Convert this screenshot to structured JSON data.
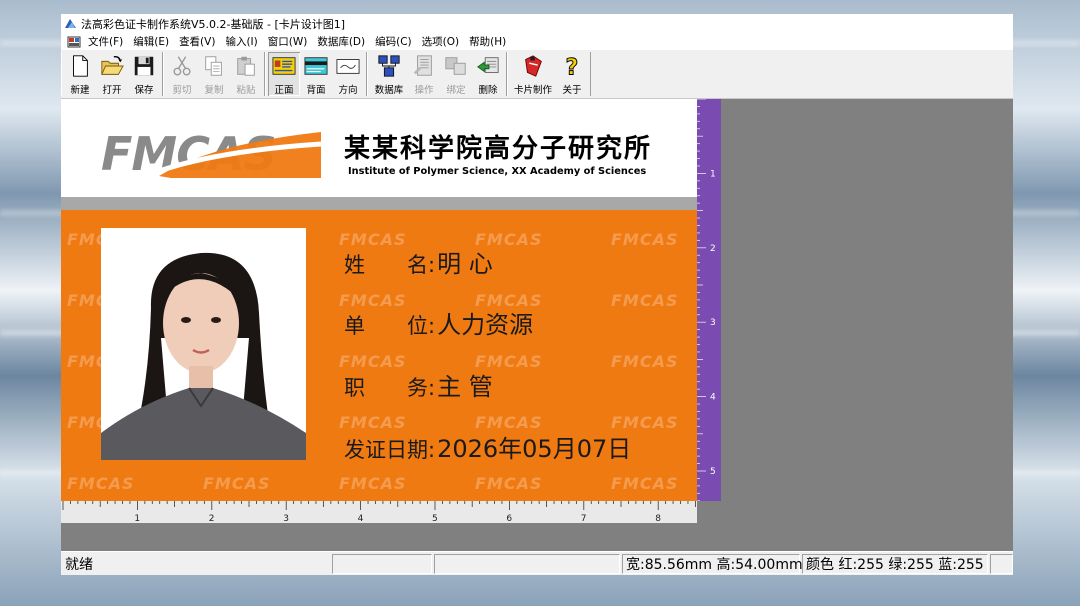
{
  "window": {
    "title": "法高彩色证卡制作系统V5.0.2-基础版 - [卡片设计图1]"
  },
  "menu": [
    "文件(F)",
    "编辑(E)",
    "查看(V)",
    "输入(I)",
    "窗口(W)",
    "数据库(D)",
    "编码(C)",
    "选项(O)",
    "帮助(H)"
  ],
  "toolbar": {
    "new": "新建",
    "open": "打开",
    "save": "保存",
    "cut": "剪切",
    "copy": "复制",
    "paste": "粘贴",
    "front": "正面",
    "back": "背面",
    "orientation": "方向",
    "database": "数据库",
    "operate": "操作",
    "bind": "绑定",
    "delete": "删除",
    "card_make": "卡片制作",
    "about": "关于"
  },
  "card": {
    "logo_text": "FMCAS",
    "org_name_cn": "某某科学院高分子研究所",
    "org_name_en": "Institute of Polymer Science, XX Academy of Sciences",
    "watermark": "FMCAS",
    "fields": [
      {
        "label": "姓　　名:",
        "value": "明 心"
      },
      {
        "label": "单　　位:",
        "value": "人力资源"
      },
      {
        "label": "职　　务:",
        "value": "主 管"
      },
      {
        "label": "发证日期:",
        "value": "2026年05月07日"
      }
    ],
    "colors": {
      "accent": "#f07a12",
      "band": "#a8a8a8",
      "logo_gray": "#8a8a8a"
    }
  },
  "rulers": {
    "horizontal": [
      "1",
      "2",
      "3",
      "4",
      "5",
      "6",
      "7",
      "8"
    ],
    "vertical": [
      "1",
      "2",
      "3",
      "4",
      "5"
    ]
  },
  "status": {
    "ready": "就绪",
    "size": "宽:85.56mm 高:54.00mm",
    "color": "颜色 红:255  绿:255 蓝:255"
  }
}
